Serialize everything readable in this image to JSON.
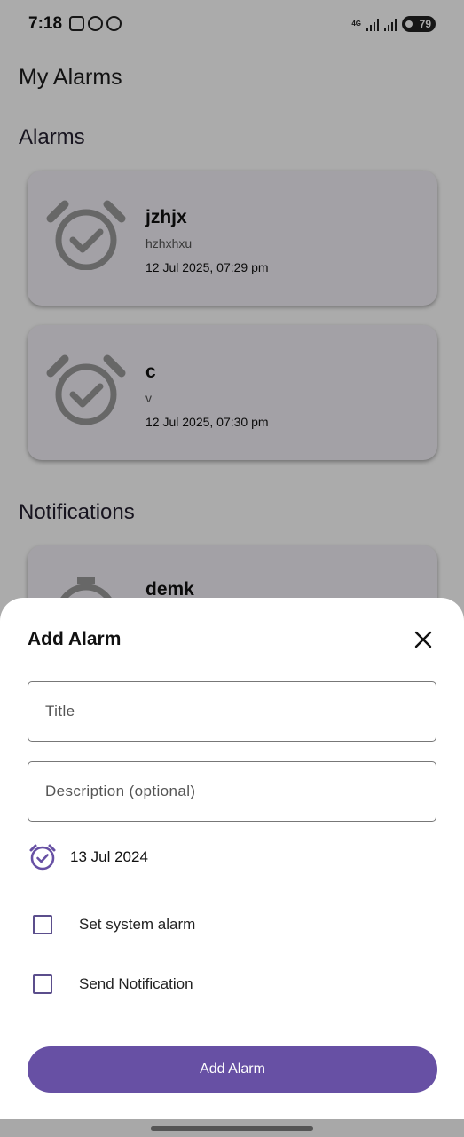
{
  "status_bar": {
    "time": "7:18",
    "network": "4G",
    "battery": "79"
  },
  "app": {
    "title": "My Alarms"
  },
  "sections": {
    "alarms_title": "Alarms",
    "notifications_title": "Notifications"
  },
  "alarms": [
    {
      "title": "jzhjx",
      "description": "hzhxhxu",
      "datetime": "12 Jul 2025, 07:29 pm"
    },
    {
      "title": "c",
      "description": "v",
      "datetime": "12 Jul 2025, 07:30 pm"
    }
  ],
  "notifications": [
    {
      "title": "demk"
    }
  ],
  "sheet": {
    "title": "Add Alarm",
    "close_icon": "close-icon",
    "title_placeholder": "Title",
    "description_placeholder": "Description (optional)",
    "date": "13 Jul 2024",
    "set_system_alarm_label": "Set system alarm",
    "send_notification_label": "Send Notification",
    "set_system_alarm_checked": false,
    "send_notification_checked": false,
    "add_button_label": "Add Alarm"
  },
  "colors": {
    "accent": "#6750a4",
    "card_background": "#f4f1f8",
    "scrim": "#000000"
  }
}
